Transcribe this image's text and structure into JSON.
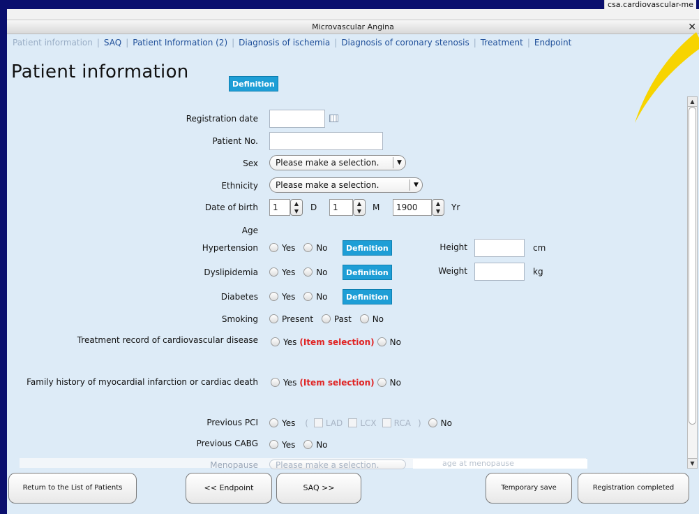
{
  "browser": {
    "url": "csa.cardiovascular-me"
  },
  "window": {
    "title": "Microvascular Angina",
    "close": "✕"
  },
  "tabs": [
    {
      "label": "Patient information",
      "active": true
    },
    {
      "label": "SAQ"
    },
    {
      "label": "Patient Information (2)"
    },
    {
      "label": "Diagnosis of ischemia"
    },
    {
      "label": "Diagnosis of coronary stenosis"
    },
    {
      "label": "Treatment"
    },
    {
      "label": "Endpoint"
    }
  ],
  "page": {
    "title": "Patient information",
    "definition_label": "Definition"
  },
  "form": {
    "registration_date": {
      "label": "Registration date",
      "value": ""
    },
    "patient_no": {
      "label": "Patient No.",
      "value": ""
    },
    "sex": {
      "label": "Sex",
      "value": "Please make a selection."
    },
    "ethnicity": {
      "label": "Ethnicity",
      "value": "Please make a selection."
    },
    "dob": {
      "label": "Date of birth",
      "day": "1",
      "day_unit": "D",
      "month": "1",
      "month_unit": "M",
      "year": "1900",
      "year_unit": "Yr"
    },
    "age": {
      "label": "Age"
    },
    "hypertension": {
      "label": "Hypertension"
    },
    "dyslipidemia": {
      "label": "Dyslipidemia"
    },
    "diabetes": {
      "label": "Diabetes"
    },
    "smoking": {
      "label": "Smoking",
      "present": "Present",
      "past": "Past",
      "no": "No"
    },
    "height": {
      "label": "Height",
      "value": "",
      "unit": "cm"
    },
    "weight": {
      "label": "Weight",
      "value": "",
      "unit": "kg"
    },
    "treatment_record": {
      "label": "Treatment record of cardiovascular disease"
    },
    "family_history": {
      "label": "Family history of myocardial infarction or cardiac death"
    },
    "previous_pci": {
      "label": "Previous PCI",
      "open": "(",
      "close": ")",
      "lad": "LAD",
      "lcx": "LCX",
      "rca": "RCA"
    },
    "previous_cabg": {
      "label": "Previous CABG"
    },
    "menopause": {
      "label": "Menopause",
      "value": "Please make a selection.",
      "age_placeholder": "age at menopause"
    },
    "yes": "Yes",
    "no": "No",
    "item_selection": "(Item selection)"
  },
  "footer": {
    "return": "Return to the List of Patients",
    "prev": "<< Endpoint",
    "next": "SAQ >>",
    "temp_save": "Temporary save",
    "complete": "Registration completed"
  },
  "colors": {
    "accent": "#1e9ed6",
    "background": "#ddebf7",
    "link": "#1f4f99",
    "warning": "#e02424"
  }
}
